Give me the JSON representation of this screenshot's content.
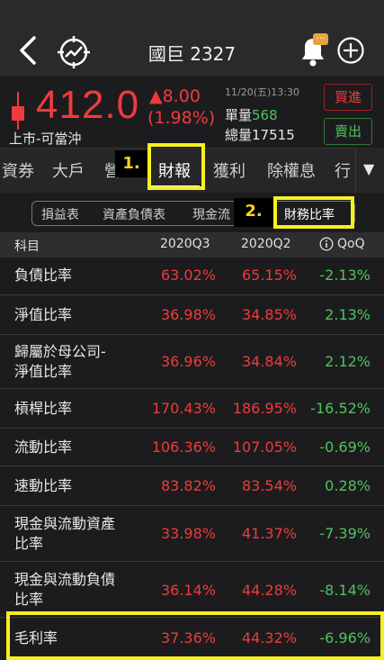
{
  "header": {
    "title": "國巨 2327",
    "bell_badge": "..."
  },
  "quote": {
    "price": "412.0",
    "change": "▲8.00",
    "change_pct": "(1.98%)",
    "market": "上市-可當沖",
    "datetime": "11/20(五)13:30",
    "unit_volume_label": "單量",
    "unit_volume": "568",
    "total_volume_label": "總量",
    "total_volume": "17515",
    "buy_label": "買進",
    "sell_label": "賣出",
    "up_color": "#ef3b3b",
    "down_color": "#4fc35a"
  },
  "tabs": [
    "資券",
    "大戶",
    "營",
    "財報",
    "獲利",
    "除權息",
    "行"
  ],
  "active_tab": "財報",
  "tabs_more_icon": "▼",
  "annotations": {
    "step1": "1.",
    "step2": "2.",
    "highlight_color": "#f6f01f"
  },
  "subtabs": [
    "損益表",
    "資產負債表",
    "現金流",
    "財務比率"
  ],
  "active_subtab": "財務比率",
  "table": {
    "headers": {
      "item": "科目",
      "q3": "2020Q3",
      "q2": "2020Q2",
      "qoq": "QoQ"
    },
    "rows": [
      {
        "label": "負債比率",
        "q3": "63.02%",
        "q2": "65.15%",
        "qoq": "-2.13%"
      },
      {
        "label": "淨值比率",
        "q3": "36.98%",
        "q2": "34.85%",
        "qoq": "2.13%"
      },
      {
        "label_line1": "歸屬於母公司-",
        "label_line2": "淨值比率",
        "q3": "36.96%",
        "q2": "34.84%",
        "qoq": "2.12%"
      },
      {
        "label": "槓桿比率",
        "q3": "170.43%",
        "q2": "186.95%",
        "qoq": "-16.52%"
      },
      {
        "label": "流動比率",
        "q3": "106.36%",
        "q2": "107.05%",
        "qoq": "-0.69%"
      },
      {
        "label": "速動比率",
        "q3": "83.82%",
        "q2": "83.54%",
        "qoq": "0.28%"
      },
      {
        "label_line1": "現金與流動資產",
        "label_line2": "比率",
        "q3": "33.98%",
        "q2": "41.37%",
        "qoq": "-7.39%"
      },
      {
        "label_line1": "現金與流動負債",
        "label_line2": "比率",
        "q3": "36.14%",
        "q2": "44.28%",
        "qoq": "-8.14%"
      },
      {
        "label": "毛利率",
        "q3": "37.36%",
        "q2": "44.32%",
        "qoq": "-6.96%"
      }
    ]
  }
}
